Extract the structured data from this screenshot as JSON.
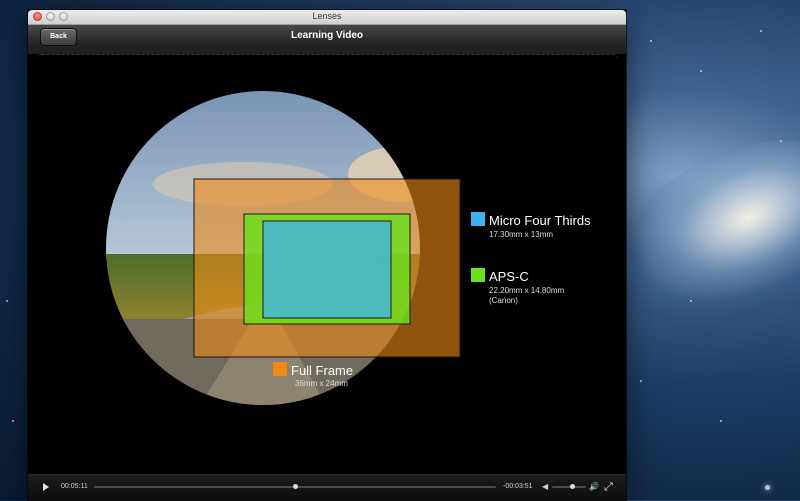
{
  "window": {
    "title": "Lenses"
  },
  "navbar": {
    "back_label": "Back",
    "title": "Learning Video"
  },
  "sensors": [
    {
      "name": "Micro Four Thirds",
      "size": "17.30mm x 13mm",
      "note": "",
      "color": "#3db2f0"
    },
    {
      "name": "APS-C",
      "size": "22.20mm x 14.80mm",
      "note": "(Canon)",
      "color": "#68e21d"
    },
    {
      "name": "Full Frame",
      "size": "36mm x 24mm",
      "note": "",
      "color": "#f08a18"
    }
  ],
  "player": {
    "elapsed": "00:05:11",
    "remaining": "-00:03:51",
    "progress": 0.5,
    "volume": 0.6
  },
  "icons": {
    "play": "play-icon",
    "volume_low": "volume-low-icon",
    "volume_high": "volume-high-icon",
    "fullscreen": "fullscreen-icon"
  }
}
